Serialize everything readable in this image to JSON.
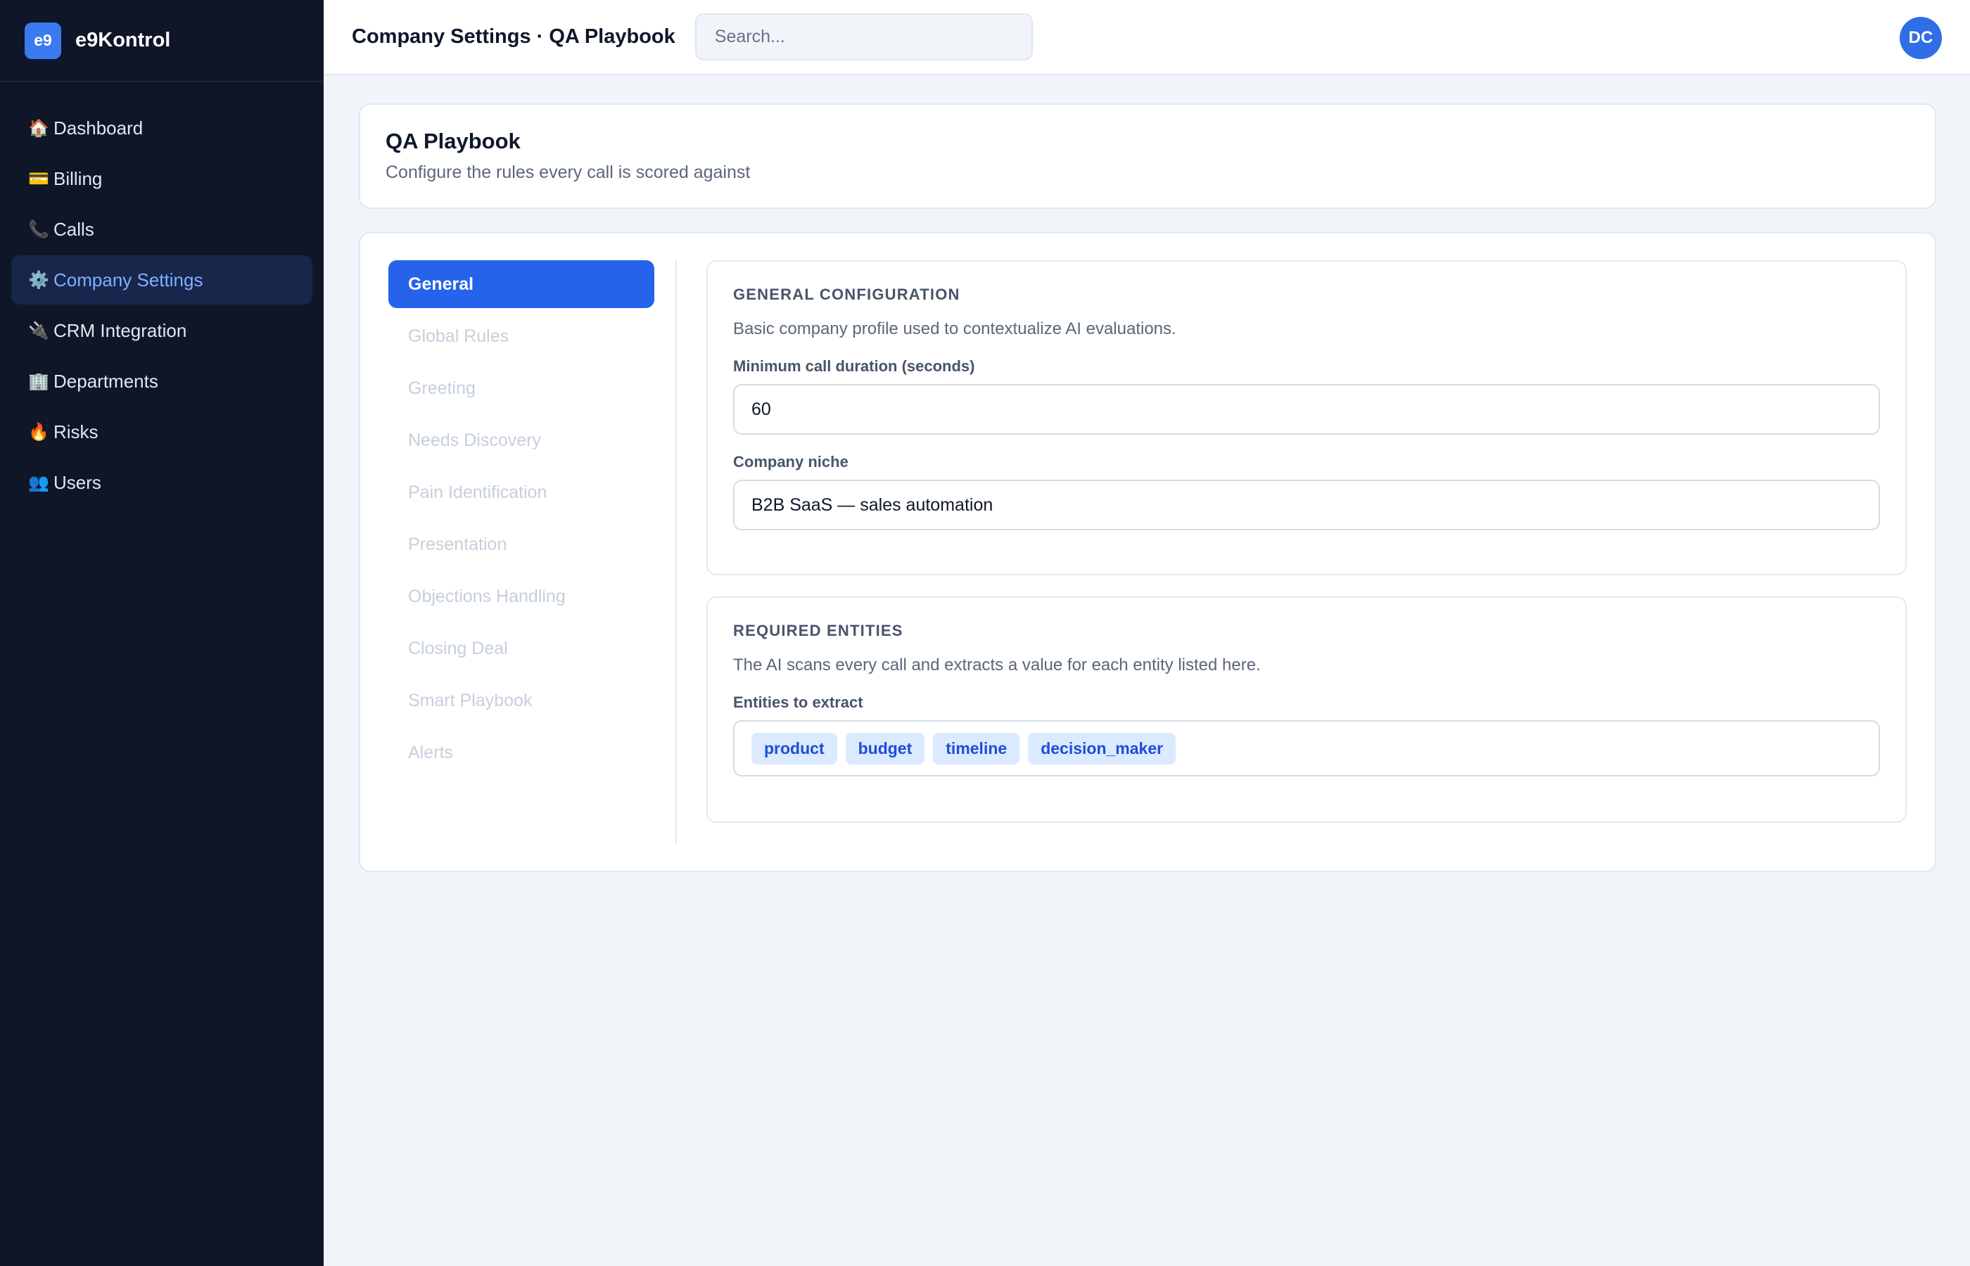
{
  "brand": {
    "logo": "e9",
    "name": "e9Kontrol"
  },
  "sidebar": {
    "items": [
      {
        "icon": "🏠",
        "icon_name": "home-icon",
        "label": "Dashboard"
      },
      {
        "icon": "💳",
        "icon_name": "credit-card-icon",
        "label": "Billing"
      },
      {
        "icon": "📞",
        "icon_name": "phone-icon",
        "label": "Calls"
      },
      {
        "icon": "⚙️",
        "icon_name": "gear-icon",
        "label": "Company Settings",
        "active": true
      },
      {
        "icon": "🔌",
        "icon_name": "plug-icon",
        "label": "CRM Integration"
      },
      {
        "icon": "🏢",
        "icon_name": "building-icon",
        "label": "Departments"
      },
      {
        "icon": "🔥",
        "icon_name": "fire-icon",
        "label": "Risks"
      },
      {
        "icon": "👥",
        "icon_name": "users-icon",
        "label": "Users"
      }
    ]
  },
  "topbar": {
    "title": "Company Settings · QA Playbook",
    "search_placeholder": "Search...",
    "avatar_initials": "DC"
  },
  "header": {
    "title": "QA Playbook",
    "subtitle": "Configure the rules every call is scored against"
  },
  "tabs": [
    {
      "label": "General",
      "active": true
    },
    {
      "label": "Global Rules"
    },
    {
      "label": "Greeting"
    },
    {
      "label": "Needs Discovery"
    },
    {
      "label": "Pain Identification"
    },
    {
      "label": "Presentation"
    },
    {
      "label": "Objections Handling"
    },
    {
      "label": "Closing Deal"
    },
    {
      "label": "Smart Playbook"
    },
    {
      "label": "Alerts"
    }
  ],
  "general": {
    "title": "GENERAL CONFIGURATION",
    "description": "Basic company profile used to contextualize AI evaluations.",
    "min_duration_label": "Minimum call duration (seconds)",
    "min_duration_value": "60",
    "niche_label": "Company niche",
    "niche_value": "B2B SaaS — sales automation"
  },
  "entities": {
    "title": "REQUIRED ENTITIES",
    "description": "The AI scans every call and extracts a value for each entity listed here.",
    "field_label": "Entities to extract",
    "chips": [
      "product",
      "budget",
      "timeline",
      "decision_maker"
    ]
  },
  "colors": {
    "sidebar_bg": "#0e1628",
    "accent": "#2563eb",
    "active_nav_text": "#7fb0ff",
    "chip_bg": "#dbeafe",
    "chip_text": "#1d4ed8"
  }
}
